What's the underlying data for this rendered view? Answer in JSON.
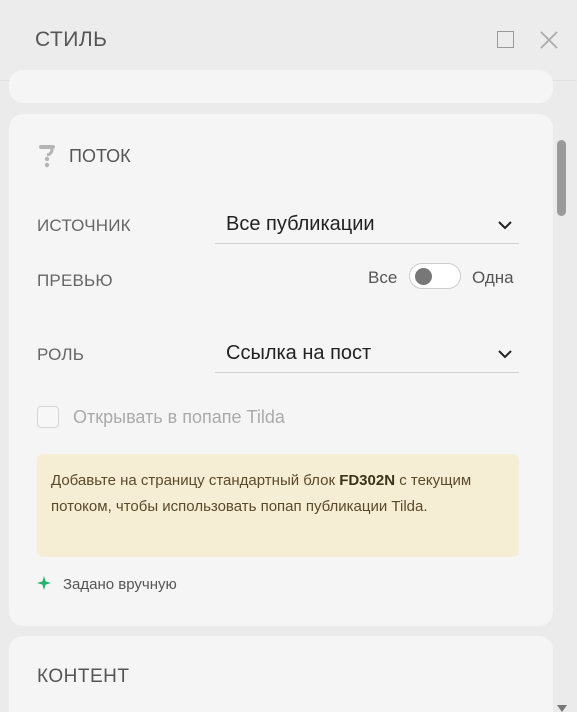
{
  "header": {
    "title": "СТИЛЬ"
  },
  "section": {
    "title": "ПОТОК"
  },
  "source": {
    "label": "ИСТОЧНИК",
    "value": "Все публикации"
  },
  "preview": {
    "label": "ПРЕВЬЮ",
    "left_option": "Все",
    "right_option": "Одна",
    "toggled_right": false
  },
  "role": {
    "label": "РОЛЬ",
    "value": "Ссылка на пост"
  },
  "popup_checkbox": {
    "label": "Открывать в попапе Tilda",
    "checked": false
  },
  "notice": {
    "text_before": "Добавьте на страницу стандартный блок ",
    "block_code": "FD302N",
    "text_after": " с текущим потоком, чтобы использовать попап публикации Tilda."
  },
  "manual": {
    "text": "Задано вручную"
  },
  "content_section": {
    "title": "КОНТЕНТ"
  },
  "colors": {
    "accent_green": "#27b36b",
    "notice_bg": "#f6edd5",
    "knob": "#777777"
  },
  "icons": {
    "section": "flow-icon",
    "manual": "sparkle-icon",
    "chevron": "chevron-down-icon",
    "close": "close-icon",
    "maximize": "maximize-icon"
  }
}
